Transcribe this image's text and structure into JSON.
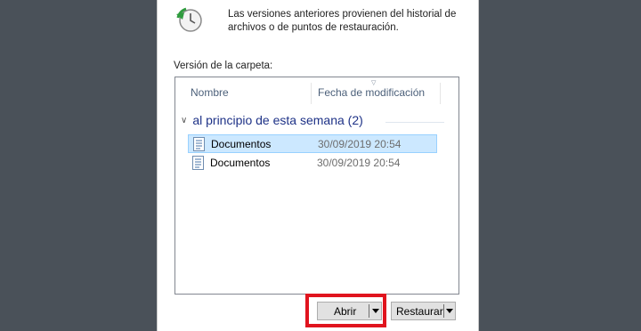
{
  "info": {
    "icon": "clock-restore-icon",
    "line1": "Las versiones anteriores provienen del historial de",
    "line2": "archivos o de puntos de restauración."
  },
  "folder_version_label": "Versión de la carpeta:",
  "list": {
    "columns": {
      "name": "Nombre",
      "modified": "Fecha de modificación"
    },
    "group": {
      "label": "al principio de esta semana (2)",
      "expanded": true
    },
    "rows": [
      {
        "name": "Documentos",
        "modified": "30/09/2019 20:54",
        "selected": true
      },
      {
        "name": "Documentos",
        "modified": "30/09/2019 20:54",
        "selected": false
      }
    ]
  },
  "buttons": {
    "open": "Abrir",
    "restore": "Restaurar"
  },
  "colors": {
    "selection": "#cce8ff",
    "group_text": "#1e3287",
    "highlight": "#e0141e"
  }
}
